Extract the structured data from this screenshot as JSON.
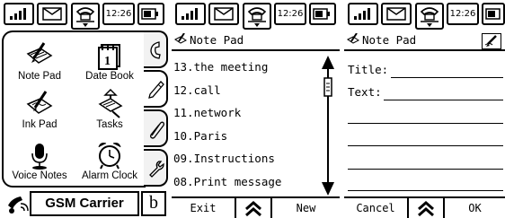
{
  "status": {
    "time": "12:26"
  },
  "launcher": {
    "apps": [
      {
        "label": "Note Pad",
        "icon": "notepad-icon"
      },
      {
        "label": "Date Book",
        "icon": "datebook-icon"
      },
      {
        "label": "Ink Pad",
        "icon": "inkpad-icon"
      },
      {
        "label": "Tasks",
        "icon": "tasks-icon"
      },
      {
        "label": "Voice Notes",
        "icon": "microphone-icon"
      },
      {
        "label": "Alarm Clock",
        "icon": "alarm-clock-icon"
      }
    ],
    "side_tabs": [
      "phone-icon",
      "pencil-icon",
      "paperclip-icon",
      "wrench-icon"
    ],
    "carrier": "GSM Carrier",
    "corner_label": "b"
  },
  "notepad": {
    "title": "Note Pad",
    "notes": [
      "13.the meeting",
      "12.call",
      "11.network",
      "10.Paris",
      "09.Instructions",
      "08.Print message"
    ],
    "buttons": {
      "exit": "Exit",
      "new": "New"
    }
  },
  "new_note": {
    "title": "Note Pad",
    "title_label": "Title:",
    "text_label": "Text:",
    "buttons": {
      "cancel": "Cancel",
      "ok": "OK"
    }
  }
}
